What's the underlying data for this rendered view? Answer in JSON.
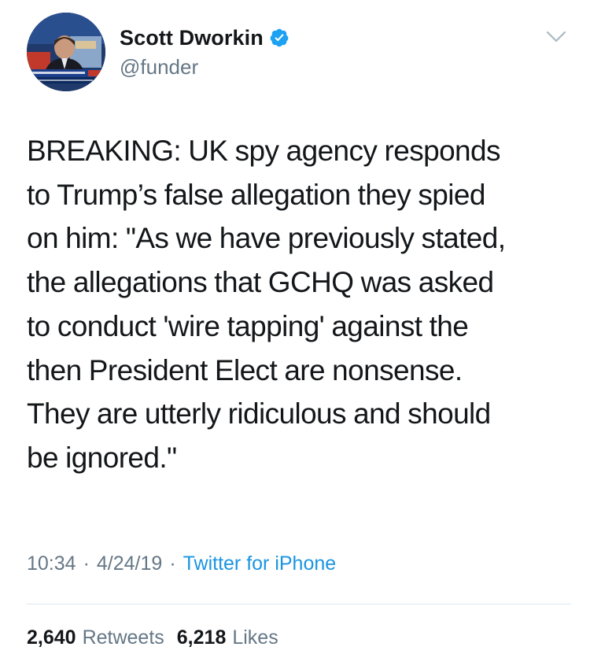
{
  "user": {
    "display_name": "Scott Dworkin",
    "handle": "@funder",
    "verified": true,
    "avatar_icon": "profile-photo"
  },
  "menu_icon": "chevron-down-icon",
  "tweet": {
    "text": "BREAKING: UK spy agency responds\nto Trump’s false allegation they spied\non him: \"As we have previously stated,\nthe allegations that GCHQ was asked\nto conduct 'wire tapping' against the\nthen President Elect are nonsense.\nThey are utterly ridiculous and should\nbe ignored.\"",
    "time": "10:34",
    "separator": "·",
    "date": "4/24/19",
    "source": "Twitter for iPhone"
  },
  "stats": {
    "retweets_count": "2,640",
    "retweets_label": "Retweets",
    "likes_count": "6,218",
    "likes_label": "Likes"
  },
  "colors": {
    "text": "#14171a",
    "secondary": "#657786",
    "link": "#1b95e0",
    "verified": "#1da1f2",
    "divider": "#e1e8ed"
  }
}
